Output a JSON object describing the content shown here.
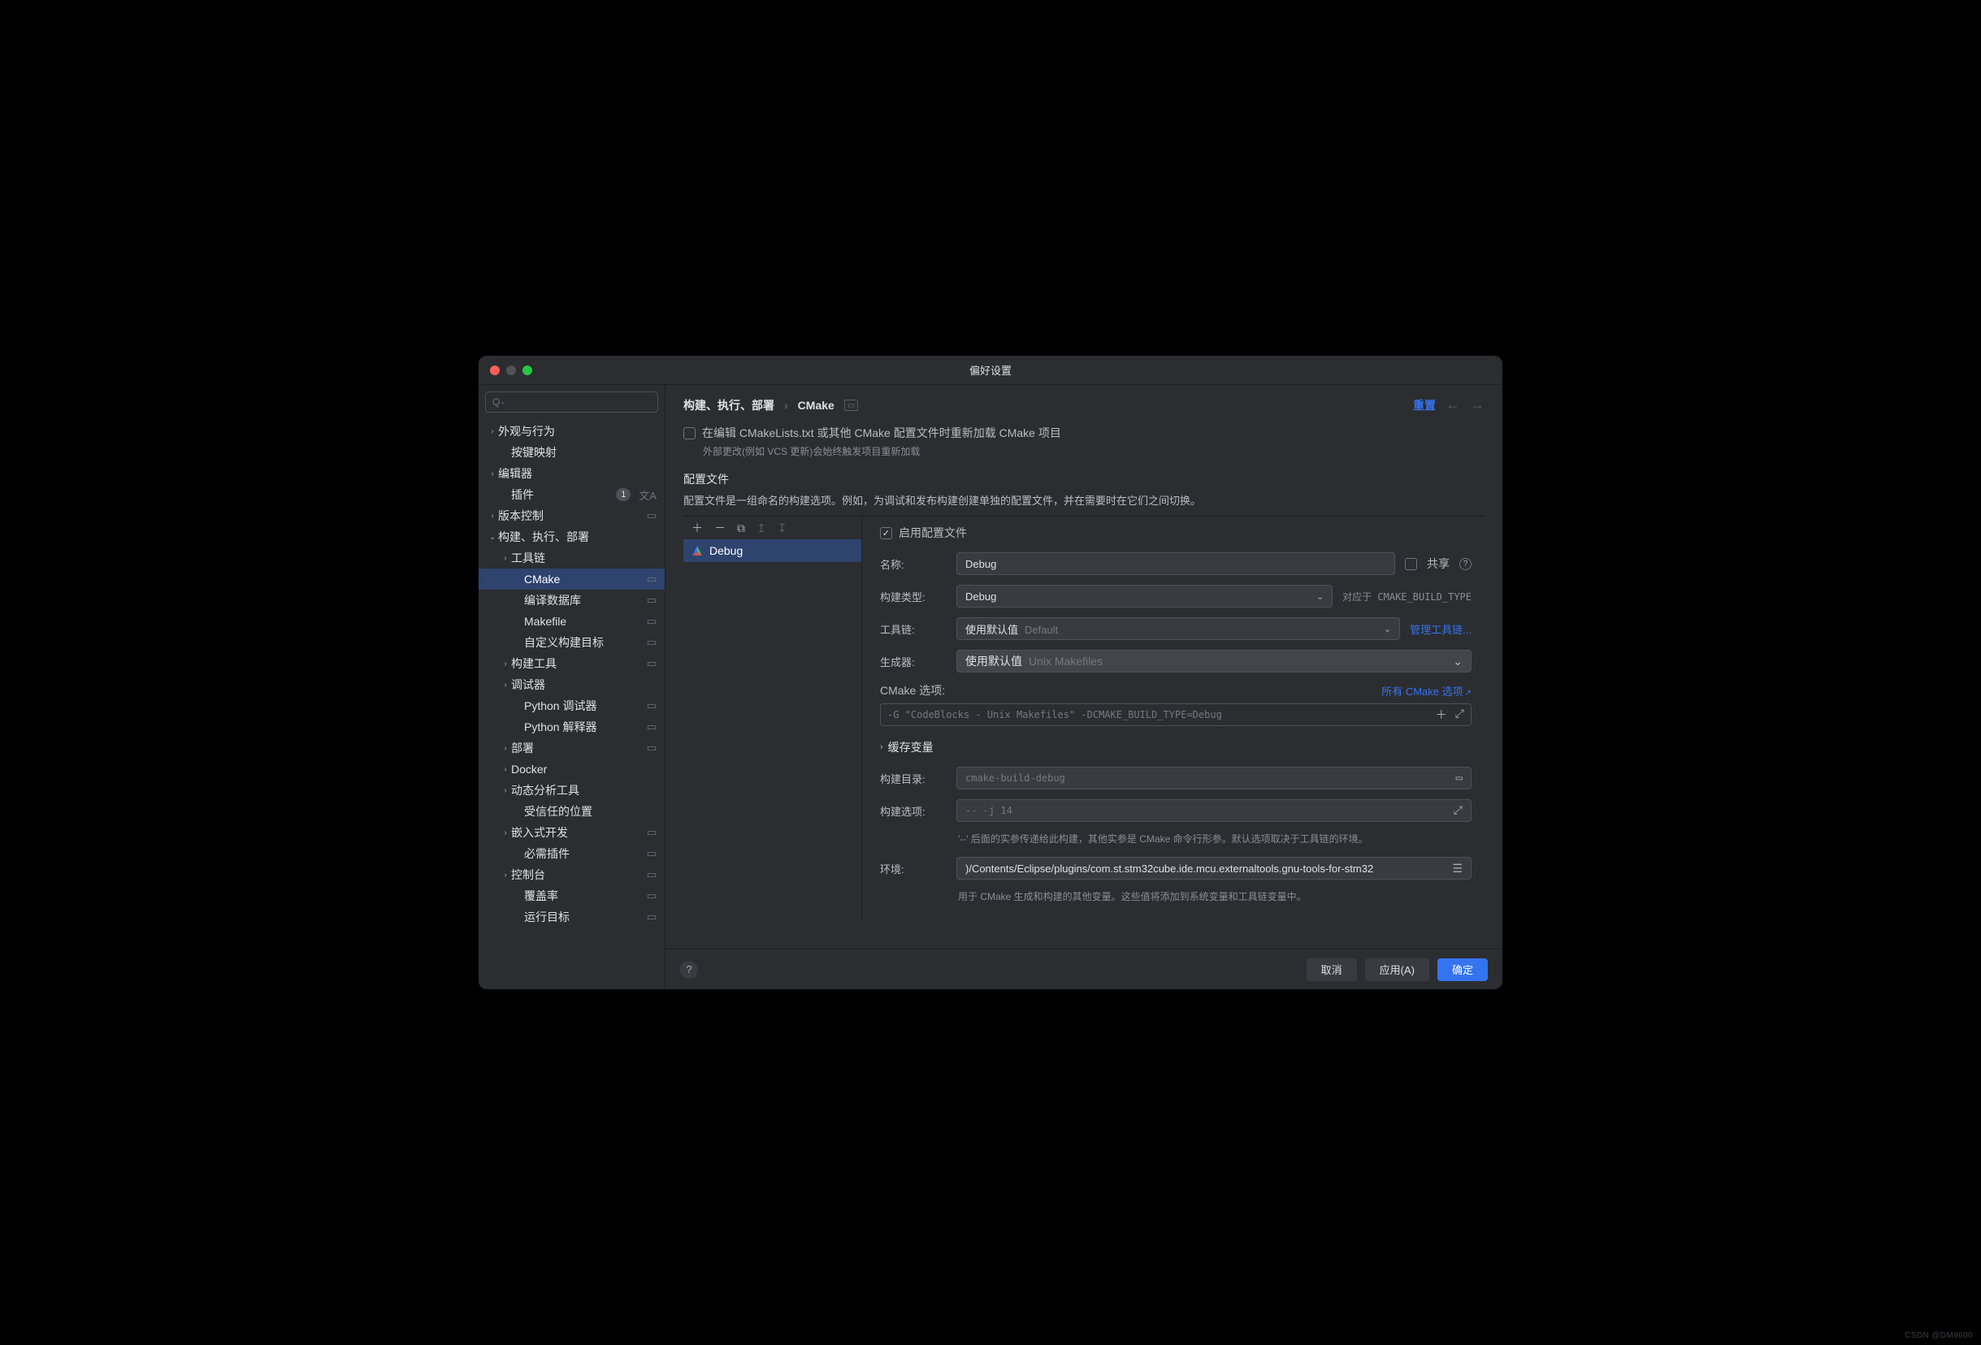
{
  "window_title": "偏好设置",
  "breadcrumb": {
    "root": "构建、执行、部署",
    "leaf": "CMake"
  },
  "reset_label": "重置",
  "reload_checkbox_label": "在编辑 CMakeLists.txt 或其他 CMake 配置文件时重新加载 CMake 项目",
  "reload_hint": "外部更改(例如 VCS 更新)会始终触发项目重新加载",
  "profiles_section_title": "配置文件",
  "profiles_section_desc": "配置文件是一组命名的构建选项。例如，为调试和发布构建创建单独的配置文件，并在需要时在它们之间切换。",
  "profile_list": [
    {
      "name": "Debug"
    }
  ],
  "form": {
    "enable_profile_label": "启用配置文件",
    "name_label": "名称:",
    "name_value": "Debug",
    "share_label": "共享",
    "build_type_label": "构建类型:",
    "build_type_value": "Debug",
    "build_type_hint": "对应于 CMAKE_BUILD_TYPE",
    "toolchain_label": "工具链:",
    "toolchain_default": "使用默认值",
    "toolchain_placeholder": "Default",
    "manage_toolchains_link": "管理工具链...",
    "generator_label": "生成器:",
    "generator_default": "使用默认值",
    "generator_placeholder": "Unix Makefiles",
    "cmake_options_label": "CMake 选项:",
    "all_cmake_options_link": "所有 CMake 选项",
    "cmake_options_value": "-G \"CodeBlocks - Unix Makefiles\" -DCMAKE_BUILD_TYPE=Debug",
    "cache_vars_label": "缓存变量",
    "build_dir_label": "构建目录:",
    "build_dir_value": "cmake-build-debug",
    "build_options_label": "构建选项:",
    "build_options_placeholder": "-- -j 14",
    "build_options_hint": "'--' 后面的实参传递给此构建，其他实参是 CMake 命令行形参。默认选项取决于工具链的环境。",
    "env_label": "环境:",
    "env_value": ")/Contents/Eclipse/plugins/com.st.stm32cube.ide.mcu.externaltools.gnu-tools-for-stm32",
    "env_hint": "用于 CMake 生成和构建的其他变量。这些值将添加到系统变量和工具链变量中。"
  },
  "sidebar": [
    {
      "label": "外观与行为",
      "depth": 0,
      "arrow": "right"
    },
    {
      "label": "按键映射",
      "depth": 1,
      "arrow": "none"
    },
    {
      "label": "编辑器",
      "depth": 0,
      "arrow": "right"
    },
    {
      "label": "插件",
      "depth": 1,
      "arrow": "none",
      "badge": "1",
      "lang": true
    },
    {
      "label": "版本控制",
      "depth": 0,
      "arrow": "right",
      "proj": true
    },
    {
      "label": "构建、执行、部署",
      "depth": 0,
      "arrow": "down"
    },
    {
      "label": "工具链",
      "depth": 1,
      "arrow": "right"
    },
    {
      "label": "CMake",
      "depth": 2,
      "arrow": "none",
      "selected": true,
      "proj": true
    },
    {
      "label": "编译数据库",
      "depth": 2,
      "arrow": "none",
      "proj": true
    },
    {
      "label": "Makefile",
      "depth": 2,
      "arrow": "none",
      "proj": true
    },
    {
      "label": "自定义构建目标",
      "depth": 2,
      "arrow": "none",
      "proj": true
    },
    {
      "label": "构建工具",
      "depth": 1,
      "arrow": "right",
      "proj": true
    },
    {
      "label": "调试器",
      "depth": 1,
      "arrow": "right"
    },
    {
      "label": "Python 调试器",
      "depth": 2,
      "arrow": "none",
      "proj": true
    },
    {
      "label": "Python 解释器",
      "depth": 2,
      "arrow": "none",
      "proj": true
    },
    {
      "label": "部署",
      "depth": 1,
      "arrow": "right",
      "proj": true
    },
    {
      "label": "Docker",
      "depth": 1,
      "arrow": "right"
    },
    {
      "label": "动态分析工具",
      "depth": 1,
      "arrow": "right"
    },
    {
      "label": "受信任的位置",
      "depth": 2,
      "arrow": "none"
    },
    {
      "label": "嵌入式开发",
      "depth": 1,
      "arrow": "right",
      "proj": true
    },
    {
      "label": "必需插件",
      "depth": 2,
      "arrow": "none",
      "proj": true
    },
    {
      "label": "控制台",
      "depth": 1,
      "arrow": "right",
      "proj": true
    },
    {
      "label": "覆盖率",
      "depth": 2,
      "arrow": "none",
      "proj": true
    },
    {
      "label": "运行目标",
      "depth": 2,
      "arrow": "none",
      "proj": true
    }
  ],
  "footer": {
    "cancel": "取消",
    "apply": "应用(A)",
    "ok": "确定"
  },
  "watermark": "CSDN @DM9600"
}
